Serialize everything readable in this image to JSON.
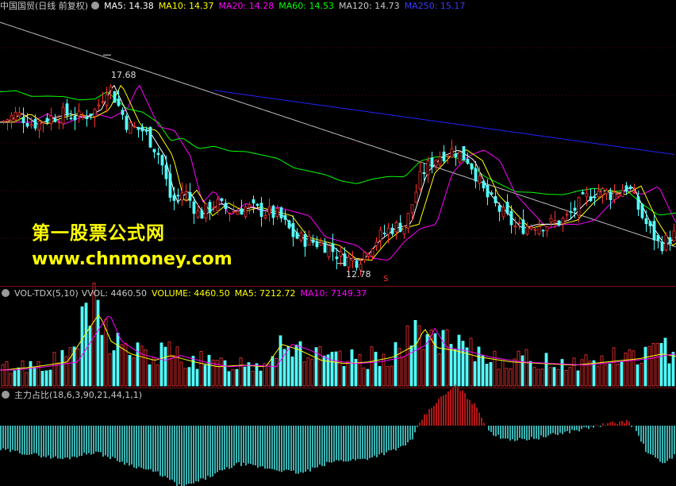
{
  "price_panel": {
    "title": "中国国贸(日线 前复权)",
    "ma5": "MA5: 14.38",
    "ma10": "MA10: 14.37",
    "ma20": "MA20: 14.28",
    "ma60": "MA60: 14.53",
    "ma120": "MA120: 14.73",
    "ma250": "MA250: 15.17",
    "high_label": "17.68",
    "low_label": "12.78",
    "signal_mark": "S",
    "colors": {
      "ma5": "#ffffff",
      "ma10": "#ffff00",
      "ma20": "#ff00ff",
      "ma60": "#00ff00",
      "ma120": "#bbbbbb",
      "ma250": "#2222ff",
      "up": "#ff3232",
      "down": "#54ffff"
    }
  },
  "watermark": {
    "line1": "第一股票公式网",
    "line2": "www.chnmoney.com"
  },
  "volume_panel": {
    "title": "VOL-TDX(5,10)",
    "vvol": "VVOL: 4460.50",
    "volume": "VOLUME: 4460.50",
    "ma5": "MA5: 7212.72",
    "ma10": "MA10: 7149.37"
  },
  "indicator_panel": {
    "title": "主力占比(18,6,3,90,21,44,1,1)"
  },
  "chart_data": {
    "type": "candlestick",
    "price_high_marker": 17.68,
    "price_low_marker": 12.78,
    "price_points": [
      [
        0,
        16.1
      ],
      [
        20,
        16.3
      ],
      [
        40,
        16.05
      ],
      [
        60,
        16.2
      ],
      [
        80,
        16.3
      ],
      [
        100,
        16.2
      ],
      [
        120,
        16.4
      ],
      [
        135,
        17.0
      ],
      [
        145,
        16.6
      ],
      [
        160,
        16.0
      ],
      [
        180,
        15.9
      ],
      [
        200,
        15.3
      ],
      [
        215,
        14.2
      ],
      [
        230,
        14.5
      ],
      [
        250,
        13.9
      ],
      [
        270,
        14.2
      ],
      [
        290,
        14.0
      ],
      [
        310,
        14.1
      ],
      [
        330,
        14.0
      ],
      [
        350,
        13.9
      ],
      [
        370,
        13.4
      ],
      [
        390,
        13.3
      ],
      [
        410,
        13.2
      ],
      [
        430,
        12.9
      ],
      [
        450,
        12.85
      ],
      [
        470,
        13.3
      ],
      [
        490,
        13.6
      ],
      [
        510,
        13.7
      ],
      [
        530,
        14.9
      ],
      [
        550,
        15.3
      ],
      [
        570,
        15.45
      ],
      [
        590,
        15.2
      ],
      [
        610,
        14.4
      ],
      [
        630,
        14.0
      ],
      [
        650,
        13.6
      ],
      [
        670,
        13.7
      ],
      [
        690,
        13.7
      ],
      [
        710,
        13.8
      ],
      [
        730,
        14.2
      ],
      [
        750,
        14.5
      ],
      [
        770,
        14.4
      ],
      [
        790,
        14.6
      ],
      [
        810,
        13.8
      ],
      [
        830,
        13.2
      ],
      [
        852,
        13.5
      ]
    ],
    "volume_points": [
      [
        0,
        1.0
      ],
      [
        40,
        1.2
      ],
      [
        80,
        1.5
      ],
      [
        110,
        3.8
      ],
      [
        120,
        4.5
      ],
      [
        135,
        2.8
      ],
      [
        160,
        2.0
      ],
      [
        190,
        1.6
      ],
      [
        210,
        1.9
      ],
      [
        240,
        1.5
      ],
      [
        270,
        1.2
      ],
      [
        300,
        1.3
      ],
      [
        330,
        1.2
      ],
      [
        350,
        2.6
      ],
      [
        370,
        2.3
      ],
      [
        400,
        1.6
      ],
      [
        430,
        1.4
      ],
      [
        460,
        1.5
      ],
      [
        490,
        1.8
      ],
      [
        520,
        2.6
      ],
      [
        530,
        3.6
      ],
      [
        545,
        2.4
      ],
      [
        570,
        2.2
      ],
      [
        600,
        1.8
      ],
      [
        640,
        1.5
      ],
      [
        680,
        1.4
      ],
      [
        720,
        1.3
      ],
      [
        760,
        1.5
      ],
      [
        800,
        1.7
      ],
      [
        830,
        2.0
      ],
      [
        852,
        1.8
      ]
    ],
    "indicator_points": [
      [
        0,
        -0.5
      ],
      [
        40,
        -0.6
      ],
      [
        80,
        -0.7
      ],
      [
        120,
        -0.55
      ],
      [
        160,
        -0.8
      ],
      [
        200,
        -1.0
      ],
      [
        230,
        -1.3
      ],
      [
        260,
        -1.1
      ],
      [
        300,
        -0.8
      ],
      [
        340,
        -0.9
      ],
      [
        380,
        -1.0
      ],
      [
        420,
        -0.75
      ],
      [
        460,
        -0.7
      ],
      [
        500,
        -0.5
      ],
      [
        520,
        -0.3
      ],
      [
        530,
        0.1
      ],
      [
        550,
        0.5
      ],
      [
        575,
        0.85
      ],
      [
        600,
        0.4
      ],
      [
        620,
        -0.2
      ],
      [
        650,
        -0.3
      ],
      [
        680,
        -0.25
      ],
      [
        710,
        -0.15
      ],
      [
        740,
        -0.05
      ],
      [
        770,
        0.05
      ],
      [
        790,
        0.1
      ],
      [
        800,
        -0.05
      ],
      [
        815,
        -0.55
      ],
      [
        835,
        -0.8
      ],
      [
        852,
        -0.6
      ]
    ]
  }
}
